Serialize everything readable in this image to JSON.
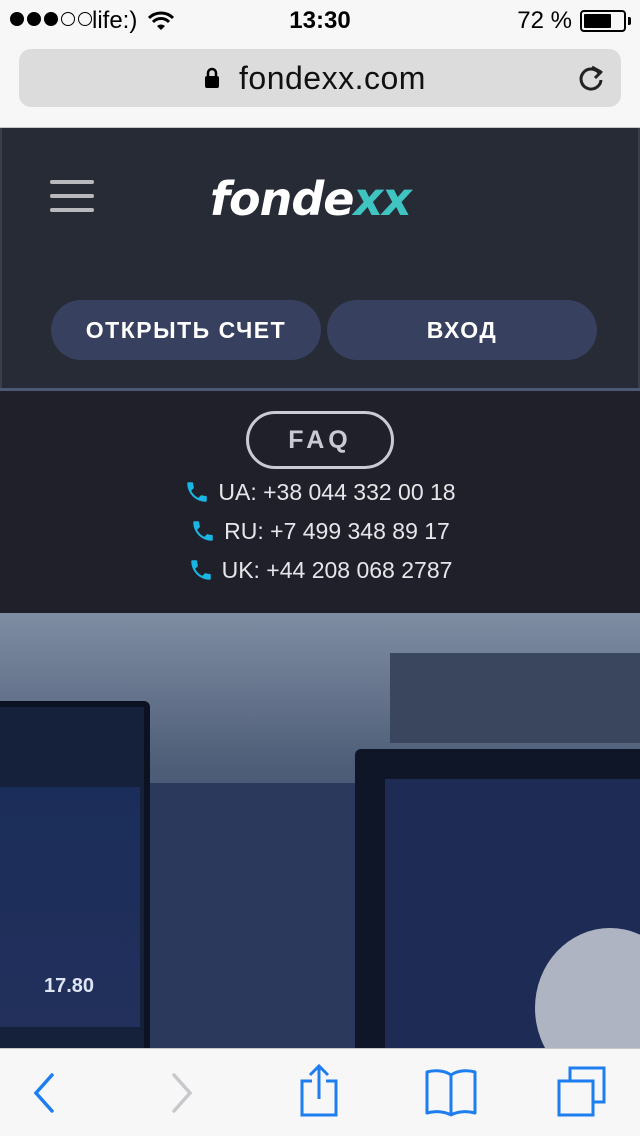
{
  "status_bar": {
    "carrier": "life:)",
    "time": "13:30",
    "battery_percent": "72 %",
    "battery_level": 0.72,
    "signal_bars_filled": 3,
    "signal_bars_total": 5
  },
  "browser": {
    "url": "fondexx.com",
    "lock_icon": "lock-icon",
    "reload_icon": "reload-icon"
  },
  "site": {
    "logo_main": "fonde",
    "logo_accent": "xx",
    "accent_color": "#3fc4c2",
    "open_account_label": "ОТКРЫТЬ СЧЕТ",
    "login_label": "ВХОД",
    "faq_label": "FAQ",
    "phone_icon": "phone-icon",
    "phones": [
      "UA: +38 044 332 00 18",
      "RU: +7 499 348 89 17",
      "UK: +44 208 068 2787"
    ]
  },
  "hero": {
    "big_number": "17.80"
  },
  "toolbar": {
    "back_icon": "back-icon",
    "forward_icon": "forward-icon",
    "share_icon": "share-icon",
    "bookmarks_icon": "bookmarks-icon",
    "tabs_icon": "tabs-icon"
  }
}
